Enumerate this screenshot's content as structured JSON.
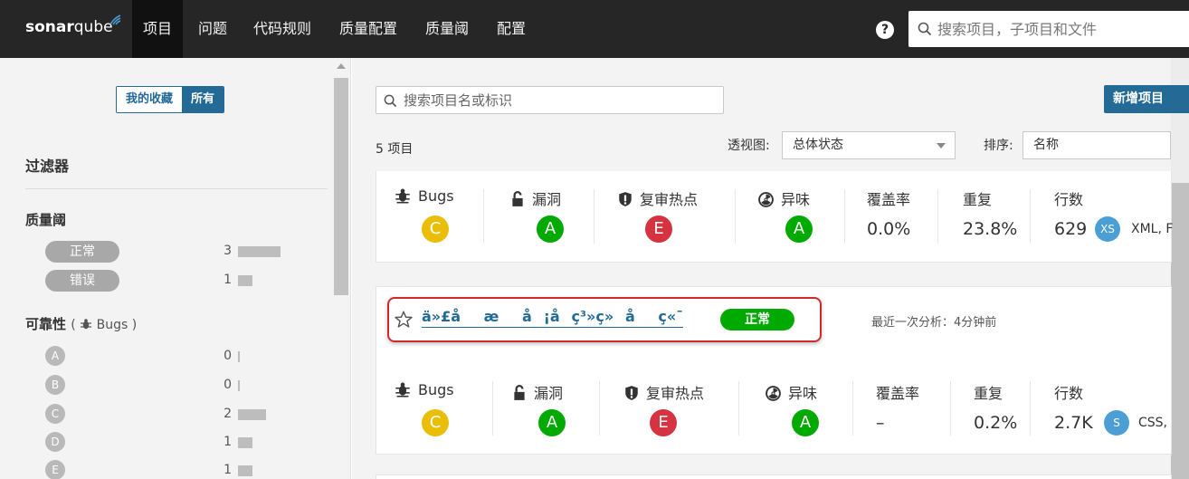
{
  "navbar": {
    "logo_sonar": "sonar",
    "logo_qube": "qube",
    "items": [
      {
        "label": "项目",
        "active": true
      },
      {
        "label": "问题"
      },
      {
        "label": "代码规则"
      },
      {
        "label": "质量配置"
      },
      {
        "label": "质量阈"
      },
      {
        "label": "配置"
      }
    ],
    "help": "?",
    "search_placeholder": "搜索项目，子项目和文件"
  },
  "sidebar": {
    "favorites_label": "我的收藏",
    "all_label": "所有",
    "filters_title": "过滤器",
    "quality_gate": {
      "title": "质量阈",
      "options": [
        {
          "label": "正常",
          "count": "3",
          "ratio": 1.0
        },
        {
          "label": "错误",
          "count": "1",
          "ratio": 0.33
        }
      ]
    },
    "reliability": {
      "title": "可靠性",
      "sub": "Bugs",
      "options": [
        {
          "label": "A",
          "count": "0",
          "ratio": 0.0
        },
        {
          "label": "B",
          "count": "0",
          "ratio": 0.0
        },
        {
          "label": "C",
          "count": "2",
          "ratio": 0.67
        },
        {
          "label": "D",
          "count": "1",
          "ratio": 0.33
        },
        {
          "label": "E",
          "count": "1",
          "ratio": 0.33
        }
      ]
    }
  },
  "main": {
    "search_placeholder": "搜索项目名或标识",
    "new_project": "新增项目",
    "project_count": "5",
    "project_count_suffix": "项目",
    "perspective_label": "透视图:",
    "perspective_value": "总体状态",
    "sort_label": "排序:",
    "sort_value": "名称"
  },
  "cards": [
    {
      "measures": {
        "bugs_label": "Bugs",
        "bugs_grade": "C",
        "vuln_label": "漏洞",
        "vuln_grade": "A",
        "hotspot_label": "复审热点",
        "hotspot_grade": "E",
        "smell_label": "异味",
        "smell_grade": "A",
        "coverage_label": "覆盖率",
        "coverage": "0.0%",
        "dup_label": "重复",
        "dup": "23.8%",
        "lines_label": "行数",
        "lines": "629",
        "size": "XS",
        "languages": "XML, F"
      }
    },
    {
      "star_icon": "star-icon",
      "name": "ä»£åæå¡åç³»ç»åç«¯",
      "quality_gate": "正常",
      "last_analysis": "最近一次分析：4分钟前",
      "measures": {
        "bugs_label": "Bugs",
        "bugs_grade": "C",
        "vuln_label": "漏洞",
        "vuln_grade": "A",
        "hotspot_label": "复审热点",
        "hotspot_grade": "E",
        "smell_label": "异味",
        "smell_grade": "A",
        "coverage_label": "覆盖率",
        "coverage": "–",
        "dup_label": "重复",
        "dup": "0.2%",
        "lines_label": "行数",
        "lines": "2.7K",
        "size": "S",
        "languages": "CSS,"
      }
    }
  ],
  "colors": {
    "navbar": "#262626",
    "primary": "#236a97",
    "grade_A": "#00aa00",
    "grade_C": "#eabe06",
    "grade_E": "#d4333f",
    "size_badge": "#4b9fd5",
    "highlight": "#d12a2a"
  }
}
